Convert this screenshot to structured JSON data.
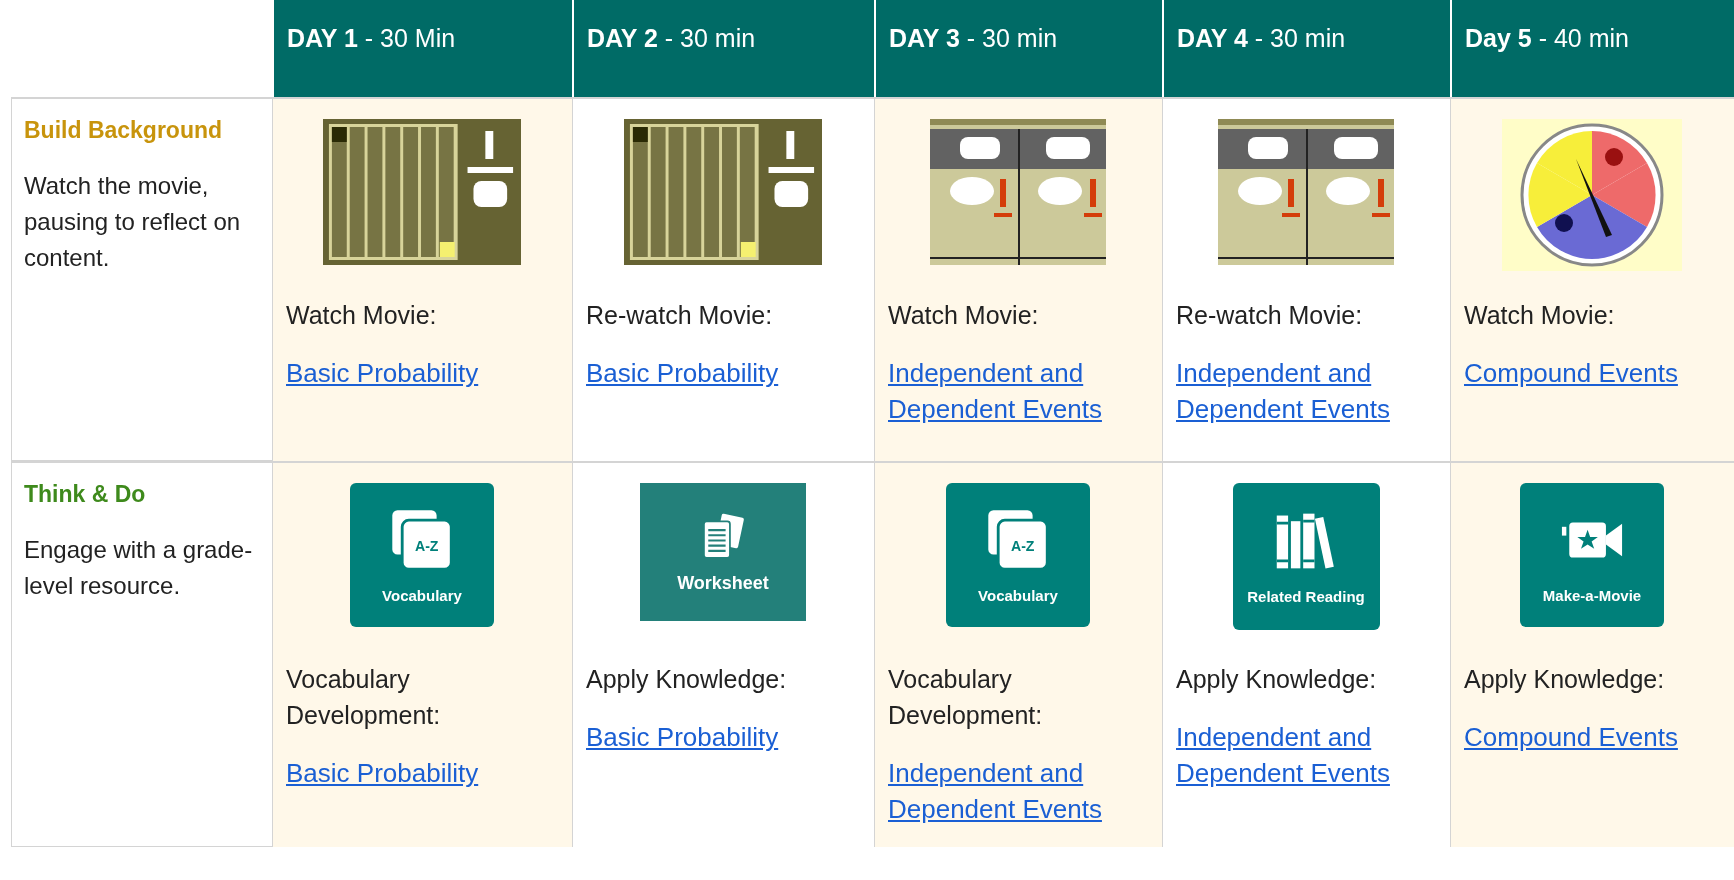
{
  "header": {
    "columns": [
      "**DAY 1** - 30 Min",
      "**DAY 2** - 30 min",
      "**DAY 3** - 30 min",
      "**DAY 4** - 30 min",
      "**Day 5** - 40 min"
    ]
  },
  "rows": [
    {
      "title": "Build Background",
      "color": "#c8940c",
      "description": "Watch the movie, pausing to reflect on content.",
      "cells": [
        {
          "prompt": "Watch Movie:",
          "link": "Basic Probability"
        },
        {
          "prompt": "Re-watch Movie:",
          "link": "Basic Probability"
        },
        {
          "prompt": "Watch Movie:",
          "link": "Independent and Dependent Events"
        },
        {
          "prompt": "Re-watch Movie:",
          "link": "Independent and Dependent Events"
        },
        {
          "prompt": "Watch Movie:",
          "link": "Compound Events"
        }
      ]
    },
    {
      "title": "Think & Do",
      "color": "#3e8a1c",
      "description": "Engage with a grade-level resource.",
      "cells": [
        {
          "media": {
            "kind": "cards",
            "badge": "A-Z",
            "label": "Vocabulary"
          },
          "prompt": "Vocabulary Development:",
          "link": "Basic Probability"
        },
        {
          "media": {
            "kind": "worksheet",
            "label": "Worksheet"
          },
          "prompt": "Apply Knowledge:",
          "link": "Basic Probability"
        },
        {
          "media": {
            "kind": "cards",
            "badge": "A-Z",
            "label": "Vocabulary"
          },
          "prompt": "Vocabulary Development:",
          "link": "Independent and Dependent Events"
        },
        {
          "media": {
            "kind": "books",
            "label": "Related Reading"
          },
          "prompt": "Apply Knowledge:",
          "link": "Independent and Dependent Events"
        },
        {
          "media": {
            "kind": "camera",
            "label": "Make-a-Movie"
          },
          "prompt": "Apply Knowledge:",
          "link": "Compound Events"
        }
      ]
    }
  ]
}
